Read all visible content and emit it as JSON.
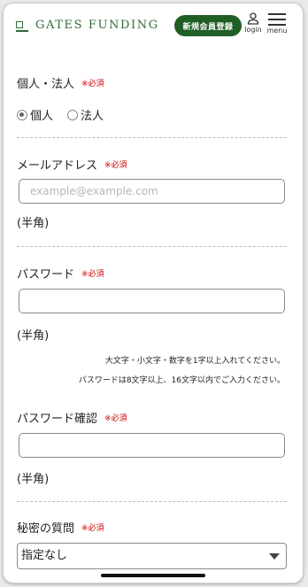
{
  "header": {
    "logo_text": "GATES FUNDING",
    "register_button": "新規会員登録",
    "login_label": "login",
    "menu_label": "menu"
  },
  "form": {
    "required_label": "※必須",
    "type": {
      "label": "個人・法人",
      "options": [
        "個人",
        "法人"
      ],
      "selected": "個人"
    },
    "email": {
      "label": "メールアドレス",
      "placeholder": "example@example.com",
      "value": "",
      "hint": "(半角)"
    },
    "password": {
      "label": "パスワード",
      "value": "",
      "hint": "(半角)",
      "notes": [
        "大文字・小文字・数字を1字以上入れてください。",
        "パスワードは8文字以上、16文字以内でご入力ください。"
      ]
    },
    "password_confirm": {
      "label": "パスワード確認",
      "value": "",
      "hint": "(半角)"
    },
    "secret_question": {
      "label": "秘密の質問",
      "selected": "指定なし"
    }
  },
  "colors": {
    "brand_green": "#1f5e25",
    "logo_green": "#2f6a3a",
    "required_red": "#d10000"
  }
}
